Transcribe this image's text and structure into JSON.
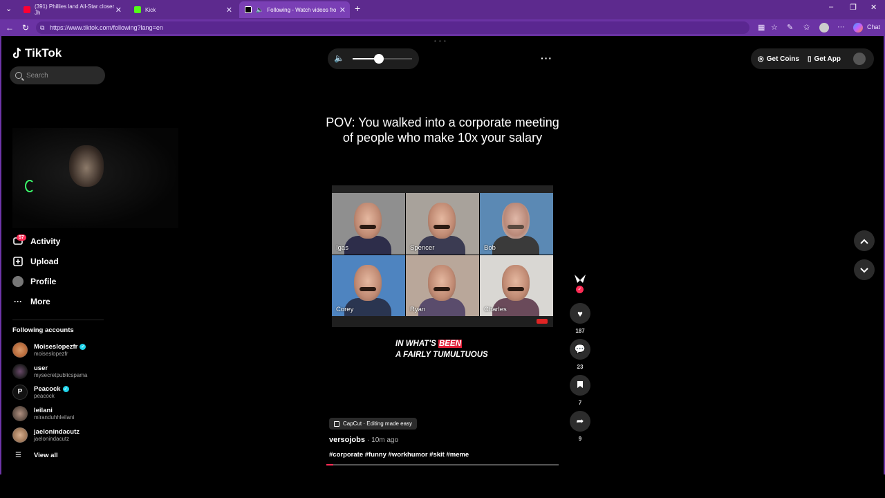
{
  "browser": {
    "tabs": [
      {
        "title": "(391) Phillies land All-Star closer Jh",
        "active": false,
        "color": "#ff0033"
      },
      {
        "title": "Kick",
        "active": false,
        "color": "#53fc18"
      },
      {
        "title": "Following - Watch videos from",
        "active": true,
        "color": "#000000"
      }
    ],
    "url": "https://www.tiktok.com/following?lang=en",
    "chat_label": "Chat"
  },
  "sidebar": {
    "logo_text": "TikTok",
    "search_placeholder": "Search",
    "activity_badge": "57",
    "menu": [
      {
        "label": "Activity",
        "icon": "activity-icon"
      },
      {
        "label": "Upload",
        "icon": "upload-icon"
      },
      {
        "label": "Profile",
        "icon": "profile-icon"
      },
      {
        "label": "More",
        "icon": "more-icon"
      }
    ],
    "following_title": "Following accounts",
    "accounts": [
      {
        "name": "Moiseslopezfr",
        "handle": "moiseslopezfr",
        "verified": true,
        "color": "#b86a3a"
      },
      {
        "name": "user",
        "handle": "mysecretpublicspama",
        "verified": false,
        "color": "#3a2a3a"
      },
      {
        "name": "Peacock",
        "handle": "peacock",
        "verified": true,
        "color": "#111111"
      },
      {
        "name": "leilani",
        "handle": "miranduhhleilani",
        "verified": false,
        "color": "#8a7060"
      },
      {
        "name": "jaelonindacutz",
        "handle": "jaelonindacutz",
        "verified": false,
        "color": "#c29a7a"
      }
    ],
    "view_all": "View all"
  },
  "header": {
    "volume_level": 0.44,
    "get_coins": "Get Coins",
    "get_app": "Get App"
  },
  "video": {
    "caption": "POV: You walked into a corporate meeting of people who make 10x your salary",
    "participants": [
      {
        "name": "Igas",
        "bg": "#8f8f8f",
        "shirt": "#2d2d4a"
      },
      {
        "name": "Spencer",
        "bg": "#a8a29b",
        "shirt": "#3b3b52"
      },
      {
        "name": "Bob",
        "bg": "#5b89b4",
        "shirt": "#3a3a3a"
      },
      {
        "name": "Corey",
        "bg": "#4e84c0",
        "shirt": "#2a3550"
      },
      {
        "name": "Ryan",
        "bg": "#b9a79a",
        "shirt": "#5a4c6c"
      },
      {
        "name": "Charles",
        "bg": "#d9d7d3",
        "shirt": "#6a4a5a"
      }
    ],
    "subtitle_line1_pre": "IN WHAT'S",
    "subtitle_line1_hl": "BEEN",
    "subtitle_line2": "A FAIRLY TUMULTUOUS",
    "capcut": "CapCut · Editing made easy",
    "author": "versojobs",
    "time_ago": "· 10m ago",
    "hashtags": "#corporate #funny #workhumor #skit #meme",
    "progress": 0.03
  },
  "actions": {
    "likes": "187",
    "comments": "23",
    "saves": "7",
    "shares": "9"
  }
}
